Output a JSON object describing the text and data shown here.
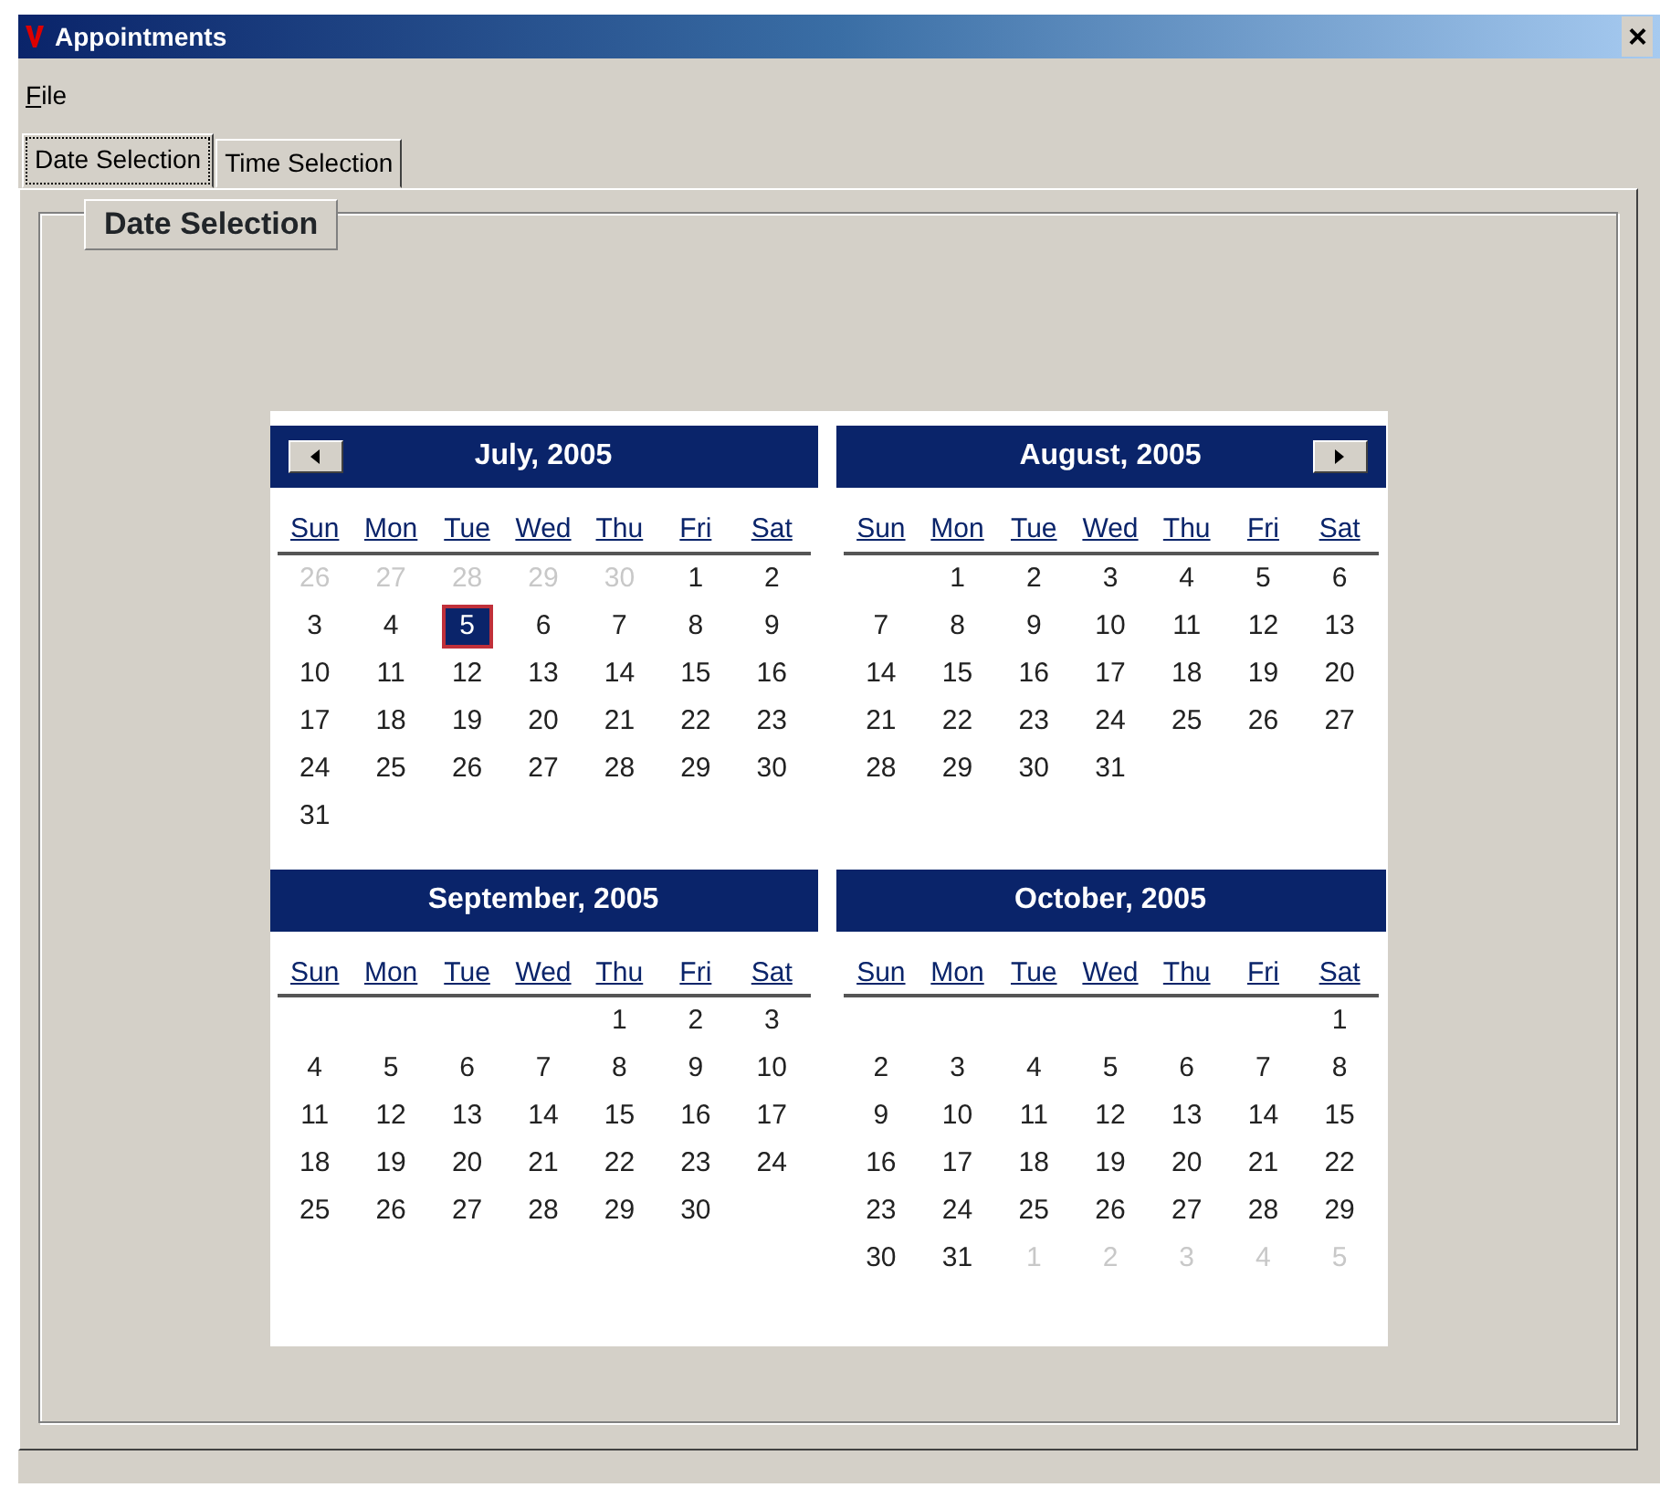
{
  "window": {
    "title": "Appointments",
    "close": "×"
  },
  "menu": [
    "File"
  ],
  "tabs": [
    {
      "label": "Date Selection",
      "selected": true
    },
    {
      "label": "Time Selection",
      "selected": false
    }
  ],
  "group": {
    "title": "Date Selection"
  },
  "months": [
    {
      "title": "July, 2005",
      "prev_button": true,
      "next_button": false,
      "weekdays": [
        "Sun",
        "Mon",
        "Tue",
        "Wed",
        "Thu",
        "Fri",
        "Sat"
      ],
      "weeks": [
        {
          "days": [
            {
              "day": "26",
              "muted": true,
              "selected": false
            },
            {
              "day": "27",
              "muted": true,
              "selected": false
            },
            {
              "day": "28",
              "muted": true,
              "selected": false
            },
            {
              "day": "29",
              "muted": true,
              "selected": false
            },
            {
              "day": "30",
              "muted": true,
              "selected": false
            },
            {
              "day": "1",
              "muted": false,
              "selected": false
            },
            {
              "day": "2",
              "muted": false,
              "selected": false
            }
          ]
        },
        {
          "days": [
            {
              "day": "3",
              "muted": false,
              "selected": false
            },
            {
              "day": "4",
              "muted": false,
              "selected": false
            },
            {
              "day": "5",
              "muted": false,
              "selected": true
            },
            {
              "day": "6",
              "muted": false,
              "selected": false
            },
            {
              "day": "7",
              "muted": false,
              "selected": false
            },
            {
              "day": "8",
              "muted": false,
              "selected": false
            },
            {
              "day": "9",
              "muted": false,
              "selected": false
            }
          ]
        },
        {
          "days": [
            {
              "day": "10",
              "muted": false,
              "selected": false
            },
            {
              "day": "11",
              "muted": false,
              "selected": false
            },
            {
              "day": "12",
              "muted": false,
              "selected": false
            },
            {
              "day": "13",
              "muted": false,
              "selected": false
            },
            {
              "day": "14",
              "muted": false,
              "selected": false
            },
            {
              "day": "15",
              "muted": false,
              "selected": false
            },
            {
              "day": "16",
              "muted": false,
              "selected": false
            }
          ]
        },
        {
          "days": [
            {
              "day": "17",
              "muted": false,
              "selected": false
            },
            {
              "day": "18",
              "muted": false,
              "selected": false
            },
            {
              "day": "19",
              "muted": false,
              "selected": false
            },
            {
              "day": "20",
              "muted": false,
              "selected": false
            },
            {
              "day": "21",
              "muted": false,
              "selected": false
            },
            {
              "day": "22",
              "muted": false,
              "selected": false
            },
            {
              "day": "23",
              "muted": false,
              "selected": false
            }
          ]
        },
        {
          "days": [
            {
              "day": "24",
              "muted": false,
              "selected": false
            },
            {
              "day": "25",
              "muted": false,
              "selected": false
            },
            {
              "day": "26",
              "muted": false,
              "selected": false
            },
            {
              "day": "27",
              "muted": false,
              "selected": false
            },
            {
              "day": "28",
              "muted": false,
              "selected": false
            },
            {
              "day": "29",
              "muted": false,
              "selected": false
            },
            {
              "day": "30",
              "muted": false,
              "selected": false
            }
          ]
        },
        {
          "align_end": false,
          "days": [
            {
              "day": "31",
              "muted": false,
              "selected": false
            }
          ]
        }
      ]
    },
    {
      "title": "August, 2005",
      "prev_button": false,
      "next_button": true,
      "weekdays": [
        "Sun",
        "Mon",
        "Tue",
        "Wed",
        "Thu",
        "Fri",
        "Sat"
      ],
      "weeks": [
        {
          "align_end": true,
          "days": [
            {
              "day": "1",
              "muted": false,
              "selected": false
            },
            {
              "day": "2",
              "muted": false,
              "selected": false
            },
            {
              "day": "3",
              "muted": false,
              "selected": false
            },
            {
              "day": "4",
              "muted": false,
              "selected": false
            },
            {
              "day": "5",
              "muted": false,
              "selected": false
            },
            {
              "day": "6",
              "muted": false,
              "selected": false
            }
          ]
        },
        {
          "days": [
            {
              "day": "7",
              "muted": false,
              "selected": false
            },
            {
              "day": "8",
              "muted": false,
              "selected": false
            },
            {
              "day": "9",
              "muted": false,
              "selected": false
            },
            {
              "day": "10",
              "muted": false,
              "selected": false
            },
            {
              "day": "11",
              "muted": false,
              "selected": false
            },
            {
              "day": "12",
              "muted": false,
              "selected": false
            },
            {
              "day": "13",
              "muted": false,
              "selected": false
            }
          ]
        },
        {
          "days": [
            {
              "day": "14",
              "muted": false,
              "selected": false
            },
            {
              "day": "15",
              "muted": false,
              "selected": false
            },
            {
              "day": "16",
              "muted": false,
              "selected": false
            },
            {
              "day": "17",
              "muted": false,
              "selected": false
            },
            {
              "day": "18",
              "muted": false,
              "selected": false
            },
            {
              "day": "19",
              "muted": false,
              "selected": false
            },
            {
              "day": "20",
              "muted": false,
              "selected": false
            }
          ]
        },
        {
          "days": [
            {
              "day": "21",
              "muted": false,
              "selected": false
            },
            {
              "day": "22",
              "muted": false,
              "selected": false
            },
            {
              "day": "23",
              "muted": false,
              "selected": false
            },
            {
              "day": "24",
              "muted": false,
              "selected": false
            },
            {
              "day": "25",
              "muted": false,
              "selected": false
            },
            {
              "day": "26",
              "muted": false,
              "selected": false
            },
            {
              "day": "27",
              "muted": false,
              "selected": false
            }
          ]
        },
        {
          "align_end": false,
          "days": [
            {
              "day": "28",
              "muted": false,
              "selected": false
            },
            {
              "day": "29",
              "muted": false,
              "selected": false
            },
            {
              "day": "30",
              "muted": false,
              "selected": false
            },
            {
              "day": "31",
              "muted": false,
              "selected": false
            }
          ]
        }
      ]
    },
    {
      "title": "September, 2005",
      "prev_button": false,
      "next_button": false,
      "weekdays": [
        "Sun",
        "Mon",
        "Tue",
        "Wed",
        "Thu",
        "Fri",
        "Sat"
      ],
      "weeks": [
        {
          "align_end": true,
          "days": [
            {
              "day": "1",
              "muted": false,
              "selected": false
            },
            {
              "day": "2",
              "muted": false,
              "selected": false
            },
            {
              "day": "3",
              "muted": false,
              "selected": false
            }
          ]
        },
        {
          "days": [
            {
              "day": "4",
              "muted": false,
              "selected": false
            },
            {
              "day": "5",
              "muted": false,
              "selected": false
            },
            {
              "day": "6",
              "muted": false,
              "selected": false
            },
            {
              "day": "7",
              "muted": false,
              "selected": false
            },
            {
              "day": "8",
              "muted": false,
              "selected": false
            },
            {
              "day": "9",
              "muted": false,
              "selected": false
            },
            {
              "day": "10",
              "muted": false,
              "selected": false
            }
          ]
        },
        {
          "days": [
            {
              "day": "11",
              "muted": false,
              "selected": false
            },
            {
              "day": "12",
              "muted": false,
              "selected": false
            },
            {
              "day": "13",
              "muted": false,
              "selected": false
            },
            {
              "day": "14",
              "muted": false,
              "selected": false
            },
            {
              "day": "15",
              "muted": false,
              "selected": false
            },
            {
              "day": "16",
              "muted": false,
              "selected": false
            },
            {
              "day": "17",
              "muted": false,
              "selected": false
            }
          ]
        },
        {
          "days": [
            {
              "day": "18",
              "muted": false,
              "selected": false
            },
            {
              "day": "19",
              "muted": false,
              "selected": false
            },
            {
              "day": "20",
              "muted": false,
              "selected": false
            },
            {
              "day": "21",
              "muted": false,
              "selected": false
            },
            {
              "day": "22",
              "muted": false,
              "selected": false
            },
            {
              "day": "23",
              "muted": false,
              "selected": false
            },
            {
              "day": "24",
              "muted": false,
              "selected": false
            }
          ]
        },
        {
          "align_end": false,
          "days": [
            {
              "day": "25",
              "muted": false,
              "selected": false
            },
            {
              "day": "26",
              "muted": false,
              "selected": false
            },
            {
              "day": "27",
              "muted": false,
              "selected": false
            },
            {
              "day": "28",
              "muted": false,
              "selected": false
            },
            {
              "day": "29",
              "muted": false,
              "selected": false
            },
            {
              "day": "30",
              "muted": false,
              "selected": false
            }
          ]
        }
      ]
    },
    {
      "title": "October, 2005",
      "prev_button": false,
      "next_button": false,
      "weekdays": [
        "Sun",
        "Mon",
        "Tue",
        "Wed",
        "Thu",
        "Fri",
        "Sat"
      ],
      "weeks": [
        {
          "align_end": true,
          "days": [
            {
              "day": "1",
              "muted": false,
              "selected": false
            }
          ]
        },
        {
          "days": [
            {
              "day": "2",
              "muted": false,
              "selected": false
            },
            {
              "day": "3",
              "muted": false,
              "selected": false
            },
            {
              "day": "4",
              "muted": false,
              "selected": false
            },
            {
              "day": "5",
              "muted": false,
              "selected": false
            },
            {
              "day": "6",
              "muted": false,
              "selected": false
            },
            {
              "day": "7",
              "muted": false,
              "selected": false
            },
            {
              "day": "8",
              "muted": false,
              "selected": false
            }
          ]
        },
        {
          "days": [
            {
              "day": "9",
              "muted": false,
              "selected": false
            },
            {
              "day": "10",
              "muted": false,
              "selected": false
            },
            {
              "day": "11",
              "muted": false,
              "selected": false
            },
            {
              "day": "12",
              "muted": false,
              "selected": false
            },
            {
              "day": "13",
              "muted": false,
              "selected": false
            },
            {
              "day": "14",
              "muted": false,
              "selected": false
            },
            {
              "day": "15",
              "muted": false,
              "selected": false
            }
          ]
        },
        {
          "days": [
            {
              "day": "16",
              "muted": false,
              "selected": false
            },
            {
              "day": "17",
              "muted": false,
              "selected": false
            },
            {
              "day": "18",
              "muted": false,
              "selected": false
            },
            {
              "day": "19",
              "muted": false,
              "selected": false
            },
            {
              "day": "20",
              "muted": false,
              "selected": false
            },
            {
              "day": "21",
              "muted": false,
              "selected": false
            },
            {
              "day": "22",
              "muted": false,
              "selected": false
            }
          ]
        },
        {
          "days": [
            {
              "day": "23",
              "muted": false,
              "selected": false
            },
            {
              "day": "24",
              "muted": false,
              "selected": false
            },
            {
              "day": "25",
              "muted": false,
              "selected": false
            },
            {
              "day": "26",
              "muted": false,
              "selected": false
            },
            {
              "day": "27",
              "muted": false,
              "selected": false
            },
            {
              "day": "28",
              "muted": false,
              "selected": false
            },
            {
              "day": "29",
              "muted": false,
              "selected": false
            }
          ]
        },
        {
          "days": [
            {
              "day": "30",
              "muted": false,
              "selected": false
            },
            {
              "day": "31",
              "muted": false,
              "selected": false
            },
            {
              "day": "1",
              "muted": true,
              "selected": false
            },
            {
              "day": "2",
              "muted": true,
              "selected": false
            },
            {
              "day": "3",
              "muted": true,
              "selected": false
            },
            {
              "day": "4",
              "muted": true,
              "selected": false
            },
            {
              "day": "5",
              "muted": true,
              "selected": false
            }
          ]
        }
      ]
    }
  ]
}
